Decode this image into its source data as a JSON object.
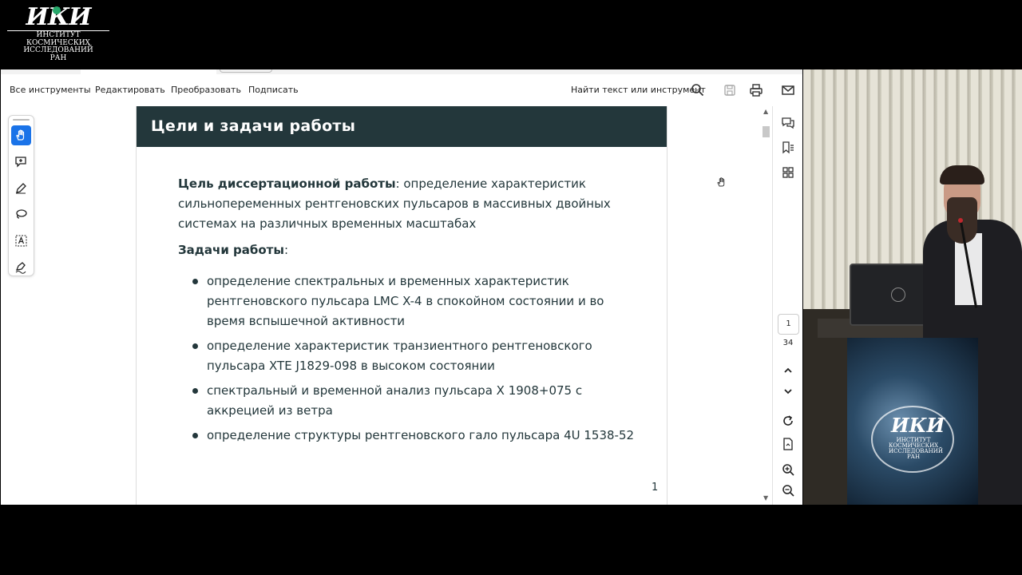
{
  "logo": {
    "mark": "ИКИ",
    "lines": [
      "ИНСТИТУТ",
      "КОСМИЧЕСКИХ",
      "ИССЛЕДОВАНИЙ",
      "РАН"
    ]
  },
  "toolbar": {
    "menus": [
      "Все инструменты",
      "Редактировать",
      "Преобразовать",
      "Подписать"
    ],
    "find_label": "Найти текст или инструмент"
  },
  "left_tools": [
    "hand-tool",
    "add-comment-tool",
    "draw-tool",
    "lasso-tool",
    "text-select-tool",
    "sign-tool"
  ],
  "slide": {
    "title": "Цели и задачи работы",
    "goal_label": "Цель диссертационной работы",
    "goal_text": ": определение характеристик сильнопеременных рентгеновских пульсаров в массивных двойных системах на различных временных масштабах",
    "tasks_label": "Задачи работы",
    "tasks_colon": ":",
    "tasks": [
      "определение спектральных и временных характеристик рентгеновского пульсара LMC X-4 в спокойном состоянии и во время вспышечной активности",
      "определение характеристик транзиентного рентгеновского пульсара XTE J1829-098 в высоком состоянии",
      "спектральный и временной анализ пульсара X 1908+075 с аккрецией из ветра",
      "определение структуры рентгеновского гало пульсара 4U 1538-52"
    ],
    "page_number": "1"
  },
  "navigation": {
    "current_page": "1",
    "total_pages": "34"
  },
  "video": {
    "banner_mark": "ИКИ",
    "banner_lines": [
      "ИНСТИТУТ",
      "КОСМИЧЕСКИХ",
      "ИССЛЕДОВАНИЙ",
      "РАН"
    ]
  },
  "colors": {
    "slide_header": "#23373b",
    "active_tool": "#1a73e8"
  }
}
